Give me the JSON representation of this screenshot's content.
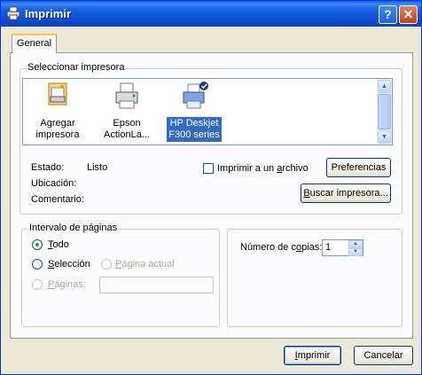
{
  "window": {
    "title": "Imprimir",
    "help_glyph": "?",
    "close_glyph": "✕"
  },
  "tabs": [
    {
      "label": "General"
    }
  ],
  "printer_section": {
    "label": "Seleccionar impresora",
    "printers": [
      {
        "line1": "Agregar",
        "line2": "impresora",
        "icon": "add-printer-icon",
        "selected": false
      },
      {
        "line1": "Epson",
        "line2": "ActionLa...",
        "icon": "printer-icon",
        "selected": false
      },
      {
        "line1": "HP Deskjet",
        "line2": "F300 series",
        "icon": "default-printer-icon",
        "selected": true
      }
    ],
    "status_label": "Estado:",
    "status_value": "Listo",
    "location_label": "Ubicación:",
    "comment_label": "Comentario:",
    "print_to_file": {
      "pre": "Imprimir a un ",
      "accel": "a",
      "post": "rchivo",
      "checked": false
    },
    "preferences_button": "Preferencias",
    "find_printer": {
      "accel": "B",
      "rest": "uscar impresora..."
    }
  },
  "page_range": {
    "label": "Intervalo de páginas",
    "all": {
      "accel": "T",
      "rest": "odo",
      "selected": true
    },
    "selection": {
      "accel": "S",
      "rest": "elección",
      "selected": false
    },
    "current_page": {
      "accel": "P",
      "rest": "ágina actual",
      "enabled": false
    },
    "pages": {
      "accel": "P",
      "rest": "áginas:",
      "enabled": false,
      "value": ""
    }
  },
  "copies": {
    "pre": "Número de c",
    "accel": "o",
    "post": "pias:",
    "value": "1"
  },
  "footer": {
    "print_button": {
      "accel": "I",
      "rest": "mprimir"
    },
    "cancel_button": "Cancelar"
  },
  "colors": {
    "titlebar": "#0a4fd1",
    "selection": "#316ac5",
    "tab_highlight": "#ffc83c"
  }
}
